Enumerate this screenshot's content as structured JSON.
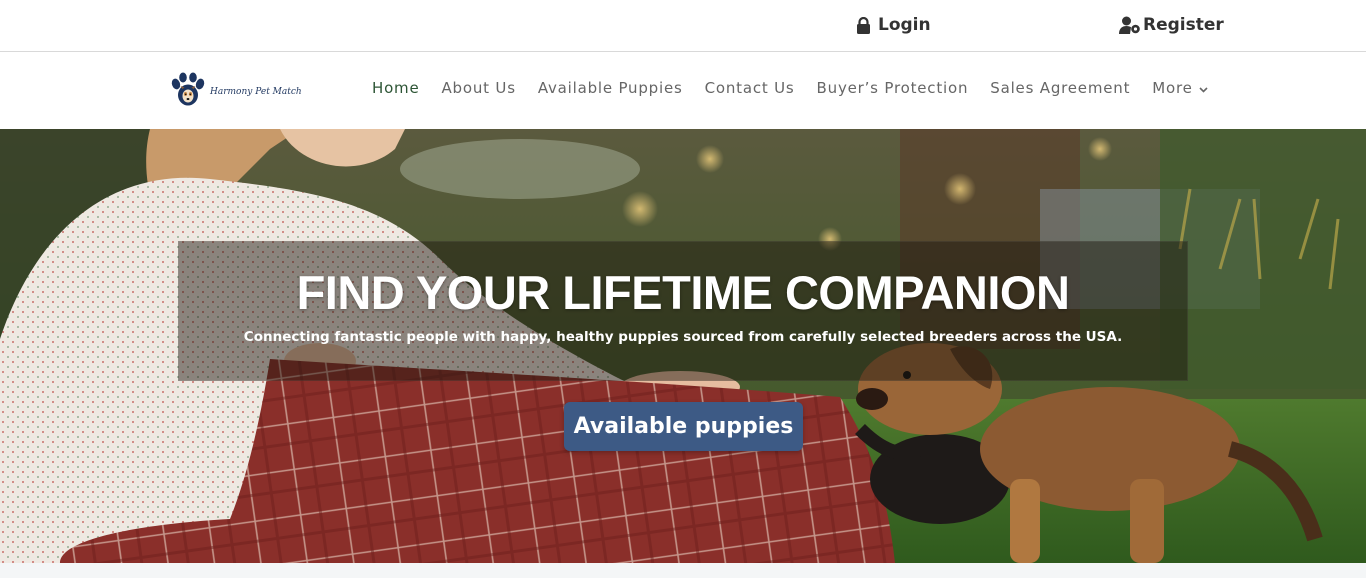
{
  "top_bar": {
    "login_label": "Login",
    "register_label": "Register",
    "icons": {
      "login": "lock-icon",
      "register": "user-settings-icon"
    }
  },
  "brand": {
    "logo_text": "Harmony Pet Match",
    "logo_icon": "paw-dog-icon",
    "logo_color": "#243b63"
  },
  "nav": {
    "items": [
      {
        "label": "Home",
        "active": true
      },
      {
        "label": "About Us",
        "active": false
      },
      {
        "label": "Available Puppies",
        "active": false
      },
      {
        "label": "Contact Us",
        "active": false
      },
      {
        "label": "Buyer’s Protection",
        "active": false
      },
      {
        "label": "Sales Agreement",
        "active": false
      },
      {
        "label": "More",
        "active": false,
        "has_dropdown": true
      }
    ],
    "active_color": "#2d5535",
    "text_color": "#666666"
  },
  "hero": {
    "title": "FIND YOUR LIFETIME COMPANION",
    "subtitle": "Connecting fantastic people with happy, healthy puppies sourced from carefully selected breeders across the USA.",
    "button_label": "Available puppies",
    "button_color": "#3d5a85"
  }
}
